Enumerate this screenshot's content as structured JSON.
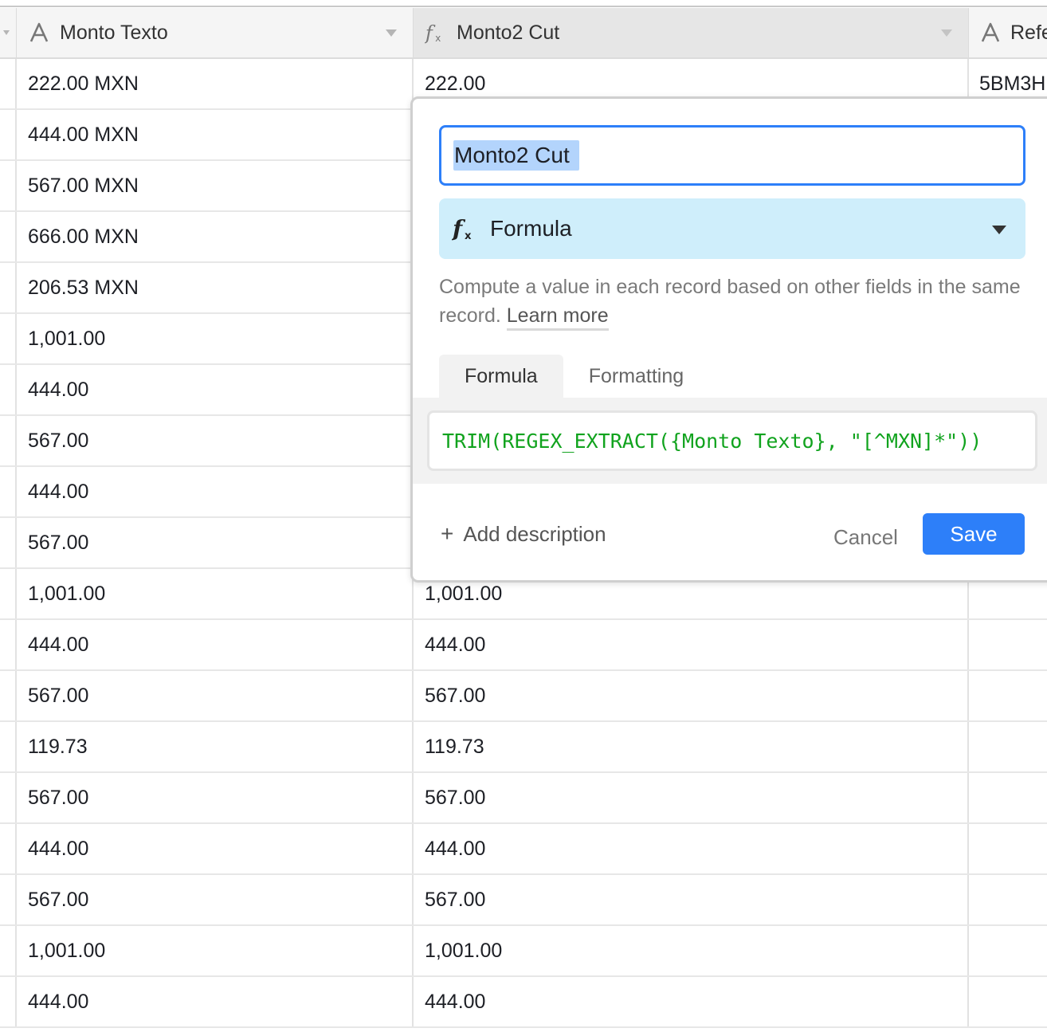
{
  "header": {
    "columns": [
      {
        "name": "Monto Texto",
        "type_icon": "text-field-icon"
      },
      {
        "name": "Monto2 Cut",
        "type_icon": "formula-icon"
      },
      {
        "name": "Refe",
        "type_icon": "text-field-icon"
      }
    ]
  },
  "rows": [
    {
      "monto_texto": "222.00 MXN",
      "monto2_cut": "222.00",
      "refe": "5BM3H"
    },
    {
      "monto_texto": "444.00 MXN",
      "monto2_cut": "",
      "refe": ""
    },
    {
      "monto_texto": "567.00 MXN",
      "monto2_cut": "",
      "refe": ""
    },
    {
      "monto_texto": "666.00 MXN",
      "monto2_cut": "",
      "refe": ""
    },
    {
      "monto_texto": "206.53 MXN",
      "monto2_cut": "",
      "refe": ""
    },
    {
      "monto_texto": "1,001.00",
      "monto2_cut": "",
      "refe": ""
    },
    {
      "monto_texto": "444.00",
      "monto2_cut": "",
      "refe": ""
    },
    {
      "monto_texto": "567.00",
      "monto2_cut": "",
      "refe": ""
    },
    {
      "monto_texto": "444.00",
      "monto2_cut": "",
      "refe": ""
    },
    {
      "monto_texto": "567.00",
      "monto2_cut": "",
      "refe": ""
    },
    {
      "monto_texto": "1,001.00",
      "monto2_cut": "1,001.00",
      "refe": ""
    },
    {
      "monto_texto": "444.00",
      "monto2_cut": "444.00",
      "refe": ""
    },
    {
      "monto_texto": "567.00",
      "monto2_cut": "567.00",
      "refe": ""
    },
    {
      "monto_texto": "119.73",
      "monto2_cut": "119.73",
      "refe": ""
    },
    {
      "monto_texto": "567.00",
      "monto2_cut": "567.00",
      "refe": ""
    },
    {
      "monto_texto": "444.00",
      "monto2_cut": "444.00",
      "refe": ""
    },
    {
      "monto_texto": "567.00",
      "monto2_cut": "567.00",
      "refe": ""
    },
    {
      "monto_texto": "1,001.00",
      "monto2_cut": "1,001.00",
      "refe": ""
    },
    {
      "monto_texto": "444.00",
      "monto2_cut": "444.00",
      "refe": ""
    }
  ],
  "popup": {
    "field_name": "Monto2 Cut",
    "field_type": "Formula",
    "description_text": "Compute a value in each record based on other fields in the same record.",
    "learn_more": "Learn more",
    "tabs": [
      {
        "label": "Formula",
        "active": true
      },
      {
        "label": "Formatting",
        "active": false
      }
    ],
    "formula": "TRIM(REGEX_EXTRACT({Monto Texto}, \"[^MXN]*\"))",
    "add_description": "Add description",
    "cancel_label": "Cancel",
    "save_label": "Save"
  },
  "colors": {
    "accent": "#2d7ff9",
    "type_select_bg": "#cfeefb",
    "formula_text": "#11a31e",
    "selection": "#b3d4fc"
  }
}
